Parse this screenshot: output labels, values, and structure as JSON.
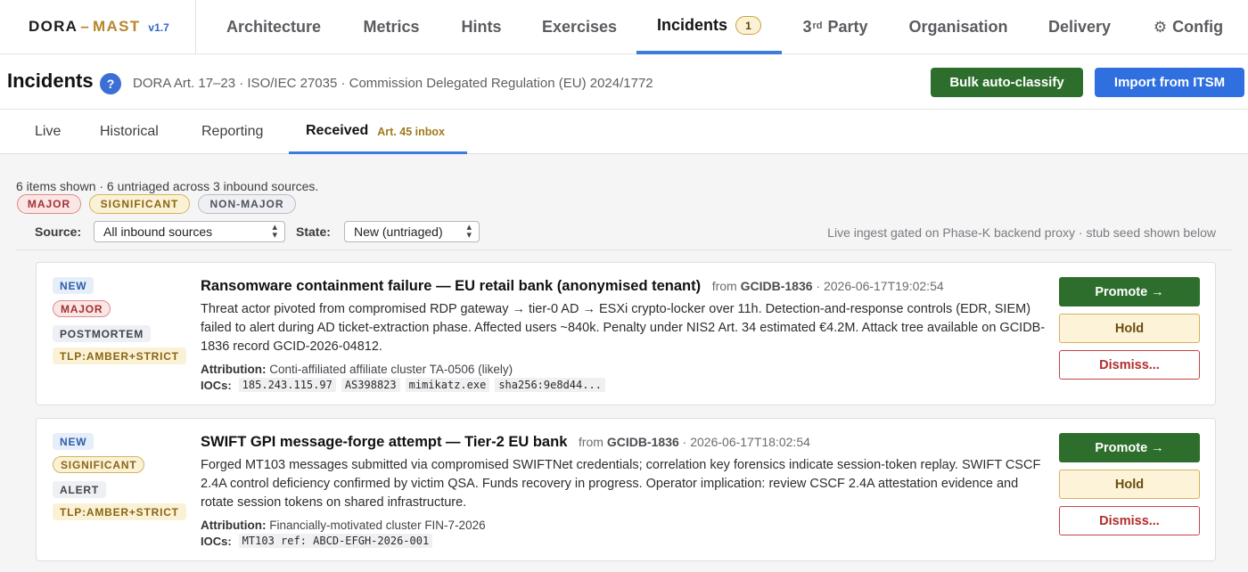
{
  "brand": {
    "name1": "DORA",
    "dash": "–",
    "name2": "MAST",
    "version": "v1.7"
  },
  "nav": {
    "architecture": "Architecture",
    "metrics": "Metrics",
    "hints": "Hints",
    "exercises": "Exercises",
    "incidents": "Incidents",
    "incidents_count": "1",
    "third_party_num": "3",
    "third_party_sup": "rd",
    "third_party_word": "Party",
    "organisation": "Organisation",
    "delivery": "Delivery",
    "config": "Config",
    "config_icon": "gear-icon",
    "active": "Incidents"
  },
  "header": {
    "title": "Incidents",
    "help_icon": "?",
    "subtitle": "DORA Art. 17–23 · ISO/IEC 27035 · Commission Delegated Regulation (EU) 2024/1772",
    "bulk_button": "Bulk auto-classify",
    "import_button": "Import from ITSM"
  },
  "subtabs": {
    "live": "Live",
    "historical": "Historical",
    "reporting": "Reporting",
    "received": "Received",
    "received_note": "Art. 45 inbox",
    "active": "Received"
  },
  "summary": {
    "text": "6 items shown · 6 untriaged across 3 inbound sources.",
    "legend": {
      "major": "MAJOR",
      "significant": "SIGNIFICANT",
      "non_major": "NON-MAJOR"
    }
  },
  "filters": {
    "source_label": "Source:",
    "source_value": "All inbound sources",
    "state_label": "State:",
    "state_value": "New (untriaged)",
    "gated_note": "Live ingest gated on Phase-K backend proxy · stub seed shown below"
  },
  "colors": {
    "accent_blue": "#2f6fe0",
    "promote_green": "#2e6e2c",
    "brand_gold": "#b8852a",
    "major_red": "#a33131"
  },
  "incidents": [
    {
      "status": "NEW",
      "severity": "MAJOR",
      "category": "POSTMORTEM",
      "tlp": "TLP:AMBER+STRICT",
      "title": "Ransomware containment failure — EU retail bank (anonymised tenant)",
      "from_prefix": "from",
      "source": "GCIDB-1836",
      "timestamp": "· 2026-06-17T19:02:54",
      "body": "Threat actor pivoted from compromised RDP gateway → tier-0 AD → ESXi crypto-locker over 11h. Detection-and-response controls (EDR, SIEM) failed to alert during AD ticket-extraction phase. Affected users ~840k. Penalty under NIS2 Art. 34 estimated €4.2M. Attack tree available on GCIDB-1836 record GCID-2026-04812.",
      "attribution_label": "Attribution:",
      "attribution": "Conti-affiliated affiliate cluster TA-0506 (likely)",
      "iocs_label": "IOCs:",
      "iocs": [
        "185.243.115.97",
        "AS398823",
        "mimikatz.exe",
        "sha256:9e8d44..."
      ],
      "promote": "Promote →",
      "hold": "Hold",
      "dismiss": "Dismiss..."
    },
    {
      "status": "NEW",
      "severity": "SIGNIFICANT",
      "category": "ALERT",
      "tlp": "TLP:AMBER+STRICT",
      "title": "SWIFT GPI message-forge attempt — Tier-2 EU bank",
      "from_prefix": "from",
      "source": "GCIDB-1836",
      "timestamp": "· 2026-06-17T18:02:54",
      "body": "Forged MT103 messages submitted via compromised SWIFTNet credentials; correlation key forensics indicate session-token replay. SWIFT CSCF 2.4A control deficiency confirmed by victim QSA. Funds recovery in progress. Operator implication: review CSCF 2.4A attestation evidence and rotate session tokens on shared infrastructure.",
      "attribution_label": "Attribution:",
      "attribution": "Financially-motivated cluster FIN-7-2026",
      "iocs_label": "IOCs:",
      "iocs": [
        "MT103 ref: ABCD-EFGH-2026-001"
      ],
      "promote": "Promote →",
      "hold": "Hold",
      "dismiss": "Dismiss..."
    }
  ]
}
